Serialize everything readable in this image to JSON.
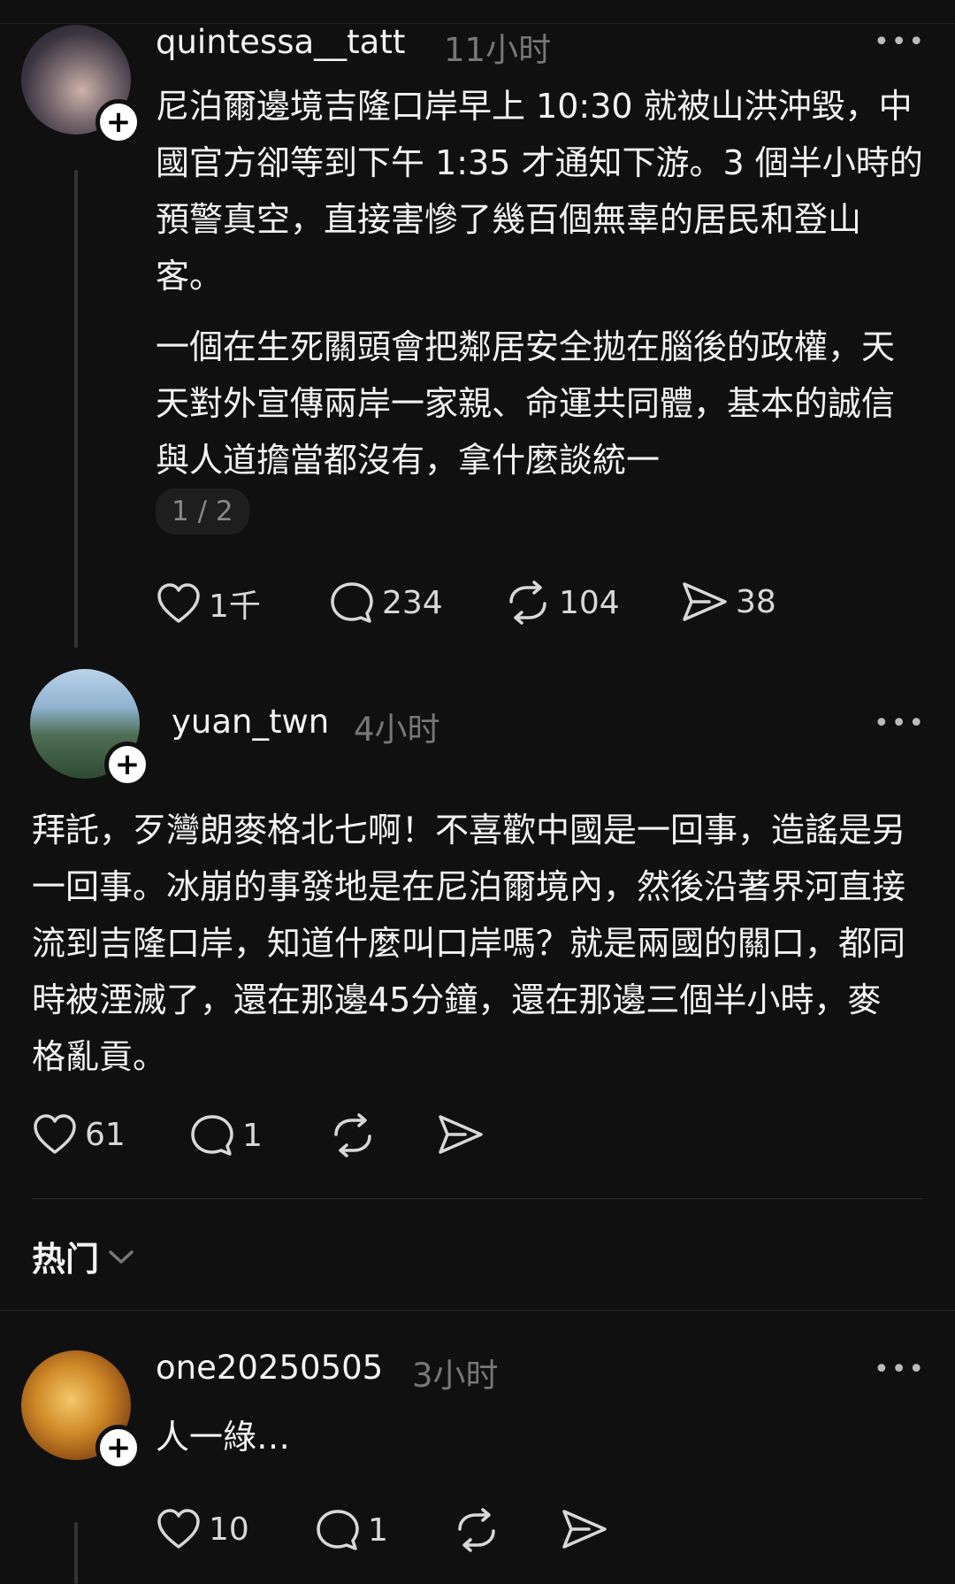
{
  "posts": [
    {
      "username": "quintessa__tatt",
      "time": "11小时",
      "paragraphs": [
        "尼泊爾邊境吉隆口岸早上 10:30 就被山洪沖毀，中國官方卻等到下午 1:35 才通知下游。3 個半小時的預警真空，直接害慘了幾百個無辜的居民和登山客。",
        "一個在生死關頭會把鄰居安全拋在腦後的政權，天天對外宣傳兩岸一家親、命運共同體，基本的誠信與人道擔當都沒有，拿什麼談統一"
      ],
      "pager": "1 / 2",
      "likes": "1千",
      "replies": "234",
      "reposts": "104",
      "shares": "38"
    },
    {
      "username": "yuan_twn",
      "time": "4小时",
      "text": "拜託，歹灣朗麥格北七啊！不喜歡中國是一回事，造謠是另一回事。冰崩的事發地是在尼泊爾境內，然後沿著界河直接流到吉隆口岸，知道什麼叫口岸嗎？就是兩國的關口，都同時被湮滅了，還在那邊45分鐘，還在那邊三個半小時，麥格亂貢。",
      "likes": "61",
      "replies": "1"
    },
    {
      "username": "one20250505",
      "time": "3小时",
      "text": "人一綠…",
      "likes": "10",
      "replies": "1"
    }
  ],
  "sort": {
    "label": "热门"
  },
  "icons": [
    "heart-icon",
    "comment-icon",
    "repost-icon",
    "share-icon",
    "more-icon",
    "plus-icon",
    "chevron-down-icon"
  ]
}
